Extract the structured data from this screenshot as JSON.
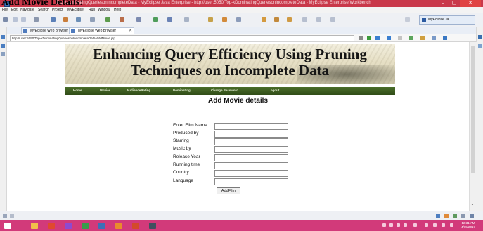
{
  "overlay": {
    "partial_title": "Add Movie Details:"
  },
  "window": {
    "title": "Top-kDominatingQueriesonIncompleteData - MyEclipse Java Enterprise - http://user:5050/Top-kDominatingQueriesonIncompleteData - MyEclipse Enterprise Workbench",
    "minimize": "–",
    "maximize": "▢",
    "close": "✕"
  },
  "menubar": [
    "File",
    "Edit",
    "Navigate",
    "Search",
    "Project",
    "MyEclipse",
    "Run",
    "Window",
    "Help"
  ],
  "perspective": {
    "label": "MyEclipse Ja..."
  },
  "tabs": [
    {
      "label": "MyEclipse Web Browser"
    },
    {
      "label": "MyEclipse Web Browser",
      "close": "✕"
    }
  ],
  "address": {
    "url": "http://user:5050/Top-kDominatingQueriesonIncompleteData/AddMovie.jsp"
  },
  "banner": {
    "title": "Enhancing Query Efficiency Using Pruning Techniques on Incomplete Data"
  },
  "nav": {
    "items": [
      "Home",
      "Movies",
      "AudienceRating",
      "Dominating",
      "Change Password",
      "Logout"
    ]
  },
  "form": {
    "heading": "Add Movie details",
    "fields": [
      {
        "label": "Enter Film Name",
        "value": ""
      },
      {
        "label": "Produced by",
        "value": ""
      },
      {
        "label": "Starring",
        "value": ""
      },
      {
        "label": "Music by",
        "value": ""
      },
      {
        "label": "Release Year",
        "value": ""
      },
      {
        "label": "Running time",
        "value": ""
      },
      {
        "label": "Country",
        "value": ""
      },
      {
        "label": "Language",
        "value": ""
      }
    ],
    "submit_label": "AddFilm"
  },
  "taskbar": {
    "time": "12:31 AM",
    "date": "4/15/2017"
  },
  "colors": {
    "titlebar": "#c9384a",
    "taskbar": "#d23a7a",
    "nav_green": "#3a5a1f",
    "banner_bg": "#e6dfc5"
  },
  "icons": [
    "app-icon",
    "back-icon",
    "forward-icon",
    "stop-icon",
    "refresh-icon",
    "home-icon",
    "search-icon",
    "scroll-down-icon"
  ]
}
